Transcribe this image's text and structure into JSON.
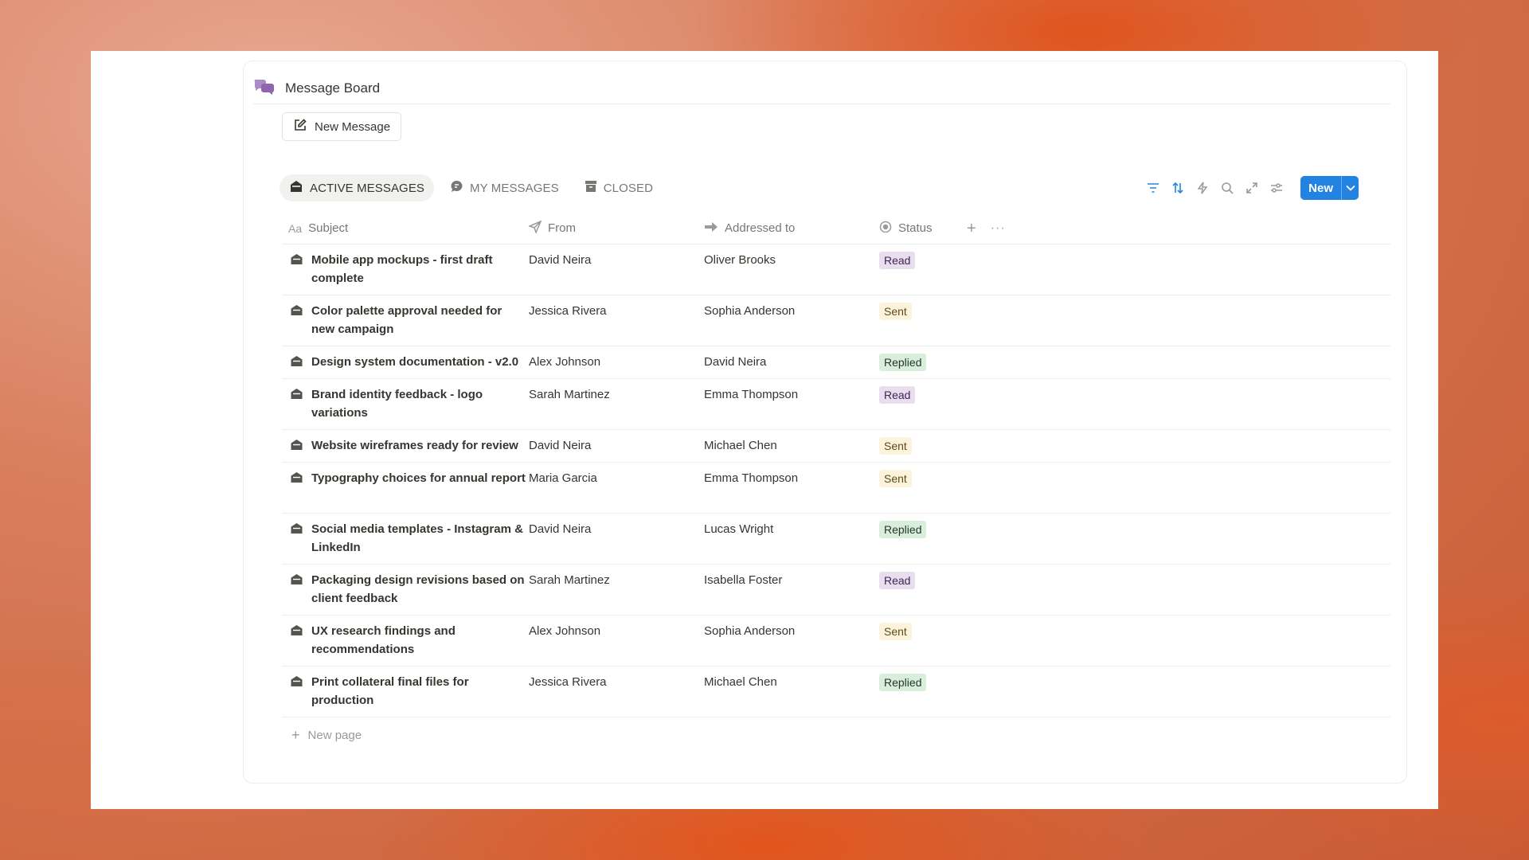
{
  "app": {
    "title": "Message Board"
  },
  "actions": {
    "new_message": "New Message",
    "new_button": "New",
    "new_page": "New page"
  },
  "tabs": [
    {
      "label": "ACTIVE MESSAGES",
      "icon": "inbox-icon",
      "active": true
    },
    {
      "label": "MY MESSAGES",
      "icon": "chat-bubble-icon",
      "active": false
    },
    {
      "label": "CLOSED",
      "icon": "archive-icon",
      "active": false
    }
  ],
  "toolbar": [
    "filter-icon",
    "sort-icon",
    "automation-icon",
    "search-icon",
    "expand-icon",
    "settings-icon"
  ],
  "columns": {
    "subject": "Subject",
    "from": "From",
    "to": "Addressed to",
    "status": "Status"
  },
  "rows": [
    {
      "subject": "Mobile app mockups - first draft complete",
      "from": "David Neira",
      "to": "Oliver Brooks",
      "status": "Read"
    },
    {
      "subject": "Color palette approval needed for new campaign",
      "from": "Jessica Rivera",
      "to": "Sophia Anderson",
      "status": "Sent"
    },
    {
      "subject": "Design system documentation - v2.0",
      "from": "Alex Johnson",
      "to": "David Neira",
      "status": "Replied"
    },
    {
      "subject": "Brand identity feedback - logo variations",
      "from": "Sarah Martinez",
      "to": "Emma Thompson",
      "status": "Read"
    },
    {
      "subject": "Website wireframes ready for review",
      "from": "David Neira",
      "to": "Michael Chen",
      "status": "Sent"
    },
    {
      "subject": "Typography choices for annual report",
      "from": "Maria Garcia",
      "to": "Emma Thompson",
      "status": "Sent"
    },
    {
      "subject": "Social media templates - Instagram & LinkedIn",
      "from": "David Neira",
      "to": "Lucas Wright",
      "status": "Replied"
    },
    {
      "subject": "Packaging design revisions based on client feedback",
      "from": "Sarah Martinez",
      "to": "Isabella Foster",
      "status": "Read"
    },
    {
      "subject": "UX research findings and recommendations",
      "from": "Alex Johnson",
      "to": "Sophia Anderson",
      "status": "Sent"
    },
    {
      "subject": "Print collateral final files for production",
      "from": "Jessica Rivera",
      "to": "Michael Chen",
      "status": "Replied"
    }
  ],
  "colors": {
    "accent": "#2383e2",
    "read_badge": "#e8deee",
    "sent_badge": "#fbf3db",
    "replied_badge": "#dbeddb",
    "title_icon": "#9065b0"
  }
}
